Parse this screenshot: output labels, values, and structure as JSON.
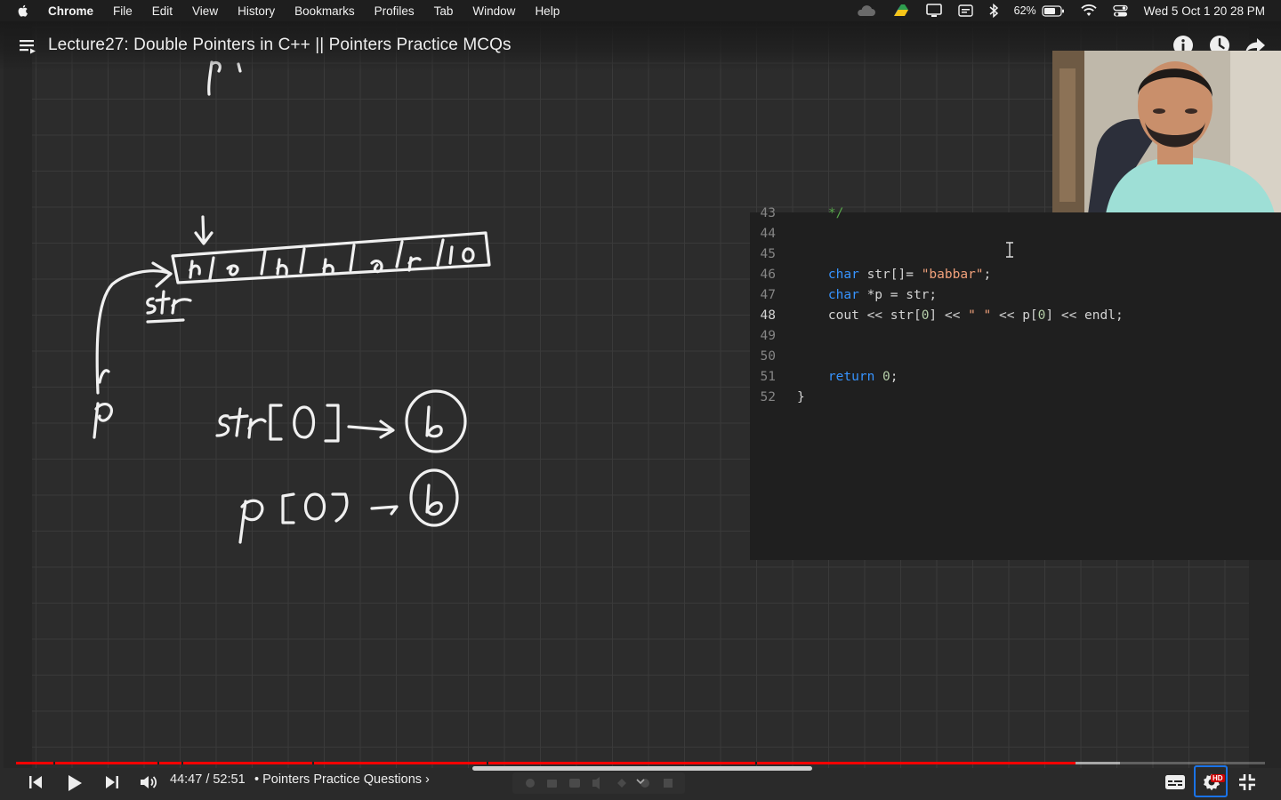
{
  "menubar": {
    "app_name": "Chrome",
    "items": [
      "File",
      "Edit",
      "View",
      "History",
      "Bookmarks",
      "Profiles",
      "Tab",
      "Window",
      "Help"
    ],
    "battery_percent": "62%",
    "clock": "Wed 5 Oct  1 20 28 PM"
  },
  "video": {
    "title": "Lecture27: Double Pointers in C++ || Pointers Practice MCQs"
  },
  "editor": {
    "lines": [
      {
        "num": "43",
        "tokens": [
          {
            "t": "    ",
            "c": ""
          },
          {
            "t": "*/",
            "c": "cmt"
          }
        ]
      },
      {
        "num": "44",
        "tokens": []
      },
      {
        "num": "45",
        "tokens": []
      },
      {
        "num": "46",
        "tokens": [
          {
            "t": "    ",
            "c": ""
          },
          {
            "t": "char",
            "c": "kw"
          },
          {
            "t": " str[]= ",
            "c": ""
          },
          {
            "t": "\"babbar\"",
            "c": "str"
          },
          {
            "t": ";",
            "c": ""
          }
        ]
      },
      {
        "num": "47",
        "tokens": [
          {
            "t": "    ",
            "c": ""
          },
          {
            "t": "char",
            "c": "kw"
          },
          {
            "t": " *p = str;",
            "c": ""
          }
        ]
      },
      {
        "num": "48",
        "active": true,
        "tokens": [
          {
            "t": "    cout << str[",
            "c": ""
          },
          {
            "t": "0",
            "c": "num"
          },
          {
            "t": "] << ",
            "c": ""
          },
          {
            "t": "\" \"",
            "c": "str"
          },
          {
            "t": " << p[",
            "c": ""
          },
          {
            "t": "0",
            "c": "num"
          },
          {
            "t": "] << endl;",
            "c": ""
          }
        ]
      },
      {
        "num": "49",
        "tokens": []
      },
      {
        "num": "50",
        "tokens": []
      },
      {
        "num": "51",
        "tokens": [
          {
            "t": "    ",
            "c": ""
          },
          {
            "t": "return",
            "c": "kw"
          },
          {
            "t": " ",
            "c": ""
          },
          {
            "t": "0",
            "c": "num"
          },
          {
            "t": ";",
            "c": ""
          }
        ]
      },
      {
        "num": "52",
        "tokens": [
          {
            "t": "}",
            "c": ""
          }
        ]
      }
    ]
  },
  "player": {
    "time": "44:47 / 52:51",
    "chapter": "• Pointers Practice Questions ›",
    "progress_fraction": 0.848,
    "buffer_fraction": 0.884,
    "hd_badge": "HD",
    "accent_color": "#ff0000"
  }
}
